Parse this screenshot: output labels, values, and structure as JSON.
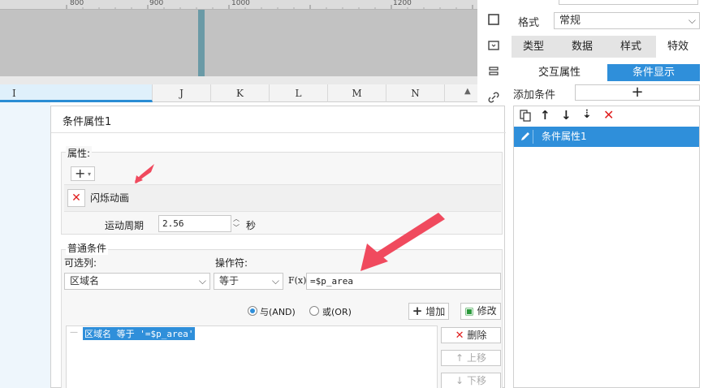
{
  "ruler": {
    "ticks": [
      "800",
      "900",
      "1000",
      "1200"
    ]
  },
  "columns": [
    "I",
    "J",
    "K",
    "L",
    "M",
    "N"
  ],
  "right_panel": {
    "format_label": "格式",
    "format_value": "常规",
    "tabs": [
      "类型",
      "数据",
      "样式",
      "特效"
    ],
    "subtabs": [
      "交互属性",
      "条件显示"
    ],
    "add_condition_label": "添加条件",
    "add_button": "+",
    "list_items": [
      "条件属性1"
    ]
  },
  "dialog": {
    "title": "条件属性1",
    "property_group": "属性:",
    "add_symbol": "+",
    "effect_name": "闪烁动画",
    "period_label": "运动周期",
    "period_value": "2.56",
    "period_unit": "秒",
    "normal_condition_group": "普通条件",
    "column_label": "可选列:",
    "operator_label": "操作符:",
    "column_value": "区域名",
    "operator_value": "等于",
    "fx_label": "F(x)",
    "formula_value": "=$p_area",
    "and_label": "与(AND)",
    "or_label": "或(OR)",
    "add_label": "增加",
    "modify_label": "修改",
    "condition_item": "区域名 等于 '=$p_area'",
    "delete_label": "删除",
    "up_label": "上移",
    "down_label": "下移"
  },
  "colors": {
    "accent_blue": "#2f8fda",
    "arrow_red": "#f04a5e",
    "delete_red": "#e02020"
  }
}
